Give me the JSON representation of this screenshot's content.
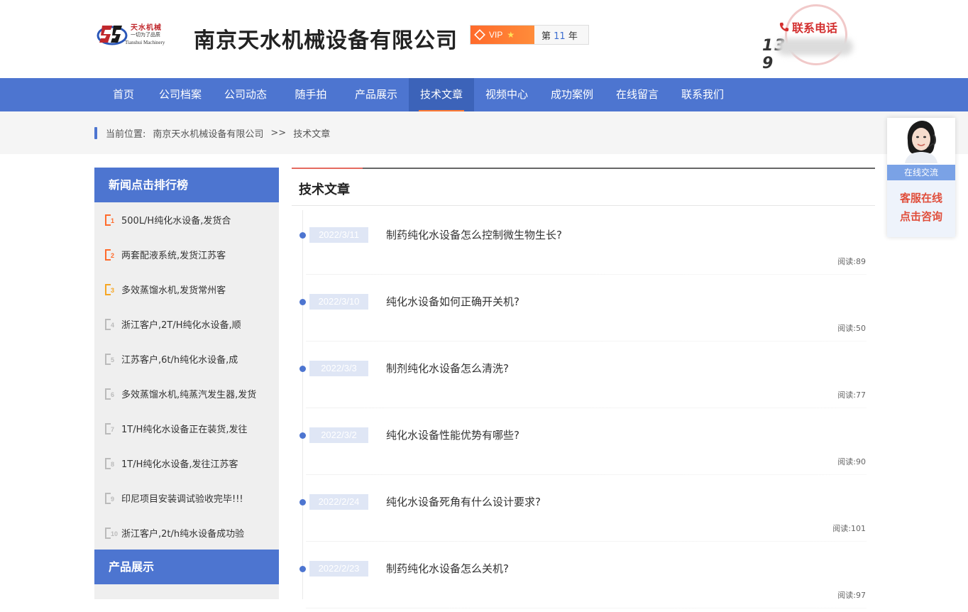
{
  "header": {
    "logo_cn": "天水机械",
    "logo_slogan": "一切为了品质",
    "logo_en": "Tianshui Machinery",
    "company_name": "南京天水机械设备有限公司",
    "vip_label": "VIP",
    "vip_years_prefix": "第",
    "vip_years": "11",
    "vip_years_suffix": "年",
    "contact_title": "联系电话",
    "contact_phone_start": "13",
    "contact_phone_end": "9"
  },
  "nav": {
    "items": [
      "首页",
      "公司档案",
      "公司动态",
      "随手拍",
      "产品展示",
      "技术文章",
      "视频中心",
      "成功案例",
      "在线留言",
      "联系我们"
    ],
    "active_index": 5
  },
  "breadcrumb": {
    "prefix": "当前位置:",
    "home": "南京天水机械设备有限公司",
    "separator": ">>",
    "current": "技术文章"
  },
  "sidebar": {
    "rank_title": "新闻点击排行榜",
    "rank_items": [
      {
        "num": "1",
        "text": "500L/H纯化水设备,发货合"
      },
      {
        "num": "2",
        "text": "两套配液系统,发货江苏客"
      },
      {
        "num": "3",
        "text": "多效蒸馏水机,发货常州客"
      },
      {
        "num": "4",
        "text": "浙江客户,2T/H纯化水设备,顺"
      },
      {
        "num": "5",
        "text": "江苏客户,6t/h纯化水设备,成"
      },
      {
        "num": "6",
        "text": "多效蒸馏水机,纯蒸汽发生器,发货"
      },
      {
        "num": "7",
        "text": "1T/H纯化水设备正在装货,发往"
      },
      {
        "num": "8",
        "text": "1T/H纯化水设备,发往江苏客"
      },
      {
        "num": "9",
        "text": "印尼项目安装调试验收完毕!!!"
      },
      {
        "num": "10",
        "text": "浙江客户,2t/h纯水设备成功验"
      }
    ],
    "product_title": "产品展示"
  },
  "main": {
    "title": "技术文章",
    "read_label": "阅读:",
    "articles": [
      {
        "date": "2022/3/11",
        "title": "制药纯化水设备怎么控制微生物生长?",
        "reads": "89"
      },
      {
        "date": "2022/3/10",
        "title": "纯化水设备如何正确开关机?",
        "reads": "50"
      },
      {
        "date": "2022/3/3",
        "title": "制剂纯化水设备怎么清洗?",
        "reads": "77"
      },
      {
        "date": "2022/3/2",
        "title": "纯化水设备性能优势有哪些?",
        "reads": "90"
      },
      {
        "date": "2022/2/24",
        "title": "纯化水设备死角有什么设计要求?",
        "reads": "101"
      },
      {
        "date": "2022/2/23",
        "title": "制药纯化水设备怎么关机?",
        "reads": "97"
      }
    ]
  },
  "service": {
    "label": "在线交流",
    "cta_line1": "客服在线",
    "cta_line2": "点击咨询"
  },
  "colors": {
    "brand_blue": "#4d75d0",
    "accent_orange": "#ff6b2c",
    "contact_red": "#d32f2f"
  }
}
